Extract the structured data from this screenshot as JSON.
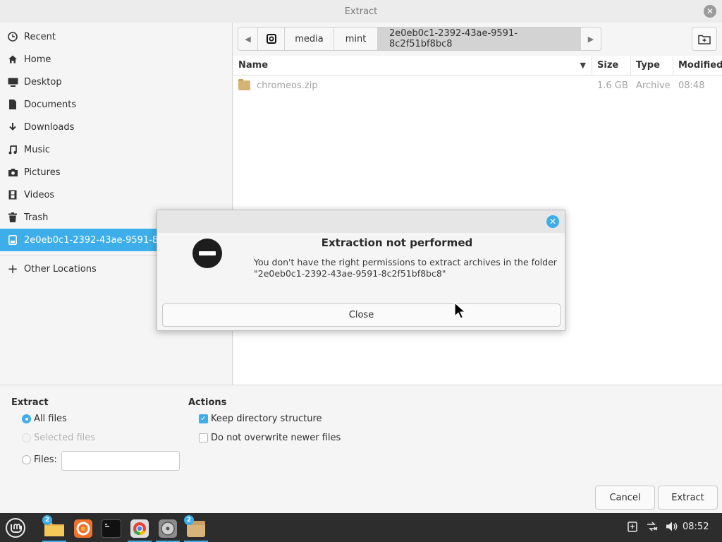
{
  "window": {
    "title": "Extract"
  },
  "sidebar": {
    "items": [
      {
        "label": "Recent",
        "icon": "clock-icon"
      },
      {
        "label": "Home",
        "icon": "home-icon"
      },
      {
        "label": "Desktop",
        "icon": "desktop-icon"
      },
      {
        "label": "Documents",
        "icon": "document-icon"
      },
      {
        "label": "Downloads",
        "icon": "download-icon"
      },
      {
        "label": "Music",
        "icon": "music-icon"
      },
      {
        "label": "Pictures",
        "icon": "camera-icon"
      },
      {
        "label": "Videos",
        "icon": "film-icon"
      },
      {
        "label": "Trash",
        "icon": "trash-icon"
      },
      {
        "label": "2e0eb0c1-2392-43ae-9591-8c2",
        "icon": "drive-icon"
      }
    ],
    "other": {
      "label": "Other Locations",
      "icon": "plus-icon"
    }
  },
  "pathbar": {
    "crumbs": [
      "media",
      "mint",
      "2e0eb0c1-2392-43ae-9591-8c2f51bf8bc8"
    ]
  },
  "filelist": {
    "columns": {
      "name": "Name",
      "size": "Size",
      "type": "Type",
      "modified": "Modified"
    },
    "rows": [
      {
        "name": "chromeos.zip",
        "size": "1.6 GB",
        "type": "Archive",
        "modified": "08:48"
      }
    ]
  },
  "options": {
    "extract_heading": "Extract",
    "all_files": "All files",
    "selected_files": "Selected files",
    "files_label": "Files:",
    "files_value": "",
    "actions_heading": "Actions",
    "keep_structure": "Keep directory structure",
    "no_overwrite": "Do not overwrite newer files",
    "cancel": "Cancel",
    "extract": "Extract"
  },
  "dialog": {
    "title": "Extraction not performed",
    "message_line1": "You don't have the right permissions to extract archives in the folder",
    "message_line2": "\"2e0eb0c1-2392-43ae-9591-8c2f51bf8bc8\"",
    "close": "Close"
  },
  "taskbar": {
    "badges": {
      "files": "2",
      "archive": "2"
    },
    "clock": "08:52"
  },
  "colors": {
    "accent": "#3daee9",
    "taskbar": "#2d2d2d"
  }
}
